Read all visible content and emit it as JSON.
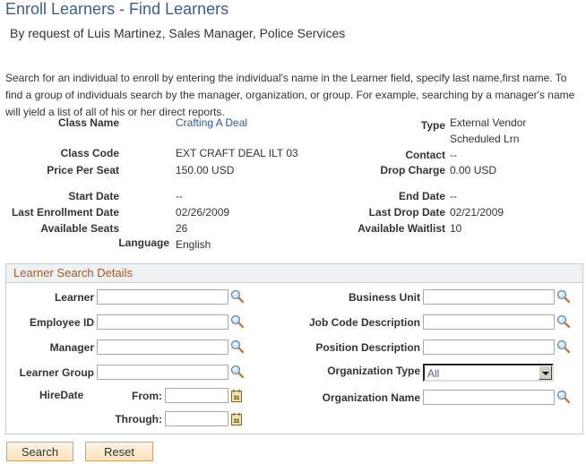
{
  "page": {
    "title": "Enroll Learners - Find Learners",
    "subtitle": "By request of Luis Martinez, Sales Manager, Police Services",
    "instructions": "Search for an individual to enroll by entering the individual's name in the Learner field, specify last name,first name. To find a group of individuals search by the manager, organization, or group. For example, searching by a manager's name will yield a list of all of his or her direct reports."
  },
  "class_info": {
    "class_name": {
      "label": "Class Name",
      "value": "Crafting A Deal"
    },
    "type": {
      "label": "Type",
      "value_line1": "External Vendor",
      "value_line2": "Scheduled Lrn"
    },
    "class_code": {
      "label": "Class Code",
      "value": "EXT CRAFT DEAL ILT 03"
    },
    "contact": {
      "label": "Contact",
      "value": "--"
    },
    "price_per_seat": {
      "label": "Price Per Seat",
      "value": "150.00 USD"
    },
    "drop_charge": {
      "label": "Drop Charge",
      "value": "0.00 USD"
    },
    "start_date": {
      "label": "Start Date",
      "value": "--"
    },
    "end_date": {
      "label": "End Date",
      "value": "--"
    },
    "last_enrollment_date": {
      "label": "Last Enrollment Date",
      "value": "02/26/2009"
    },
    "last_drop_date": {
      "label": "Last Drop Date",
      "value": "02/21/2009"
    },
    "available_seats": {
      "label": "Available Seats",
      "value": "26"
    },
    "available_waitlist": {
      "label": "Available Waitlist",
      "value": "10"
    },
    "language": {
      "label": "Language",
      "value": "English"
    }
  },
  "search": {
    "header": "Learner Search Details",
    "learner": {
      "label": "Learner",
      "value": ""
    },
    "employee_id": {
      "label": "Employee ID",
      "value": ""
    },
    "manager": {
      "label": "Manager",
      "value": ""
    },
    "learner_group": {
      "label": "Learner Group",
      "value": ""
    },
    "hire_date": {
      "label": "HireDate",
      "from_label": "From:",
      "from_value": "",
      "through_label": "Through:",
      "through_value": ""
    },
    "business_unit": {
      "label": "Business Unit",
      "value": ""
    },
    "job_code_description": {
      "label": "Job Code Description",
      "value": ""
    },
    "position_description": {
      "label": "Position Description",
      "value": ""
    },
    "organization_type": {
      "label": "Organization Type",
      "selected": "All"
    },
    "organization_name": {
      "label": "Organization Name",
      "value": ""
    }
  },
  "buttons": {
    "search": "Search",
    "reset": "Reset"
  },
  "icons": {
    "lookup": "magnifier-lookup-icon",
    "calendar": "calendar-icon",
    "dropdown": "chevron-down-icon"
  },
  "colors": {
    "title": "#3b5f8a",
    "link": "#2c5a9b",
    "group_header_text": "#a5572a",
    "group_header_bg": "#eef2f5",
    "button_border": "#d5a06a"
  }
}
